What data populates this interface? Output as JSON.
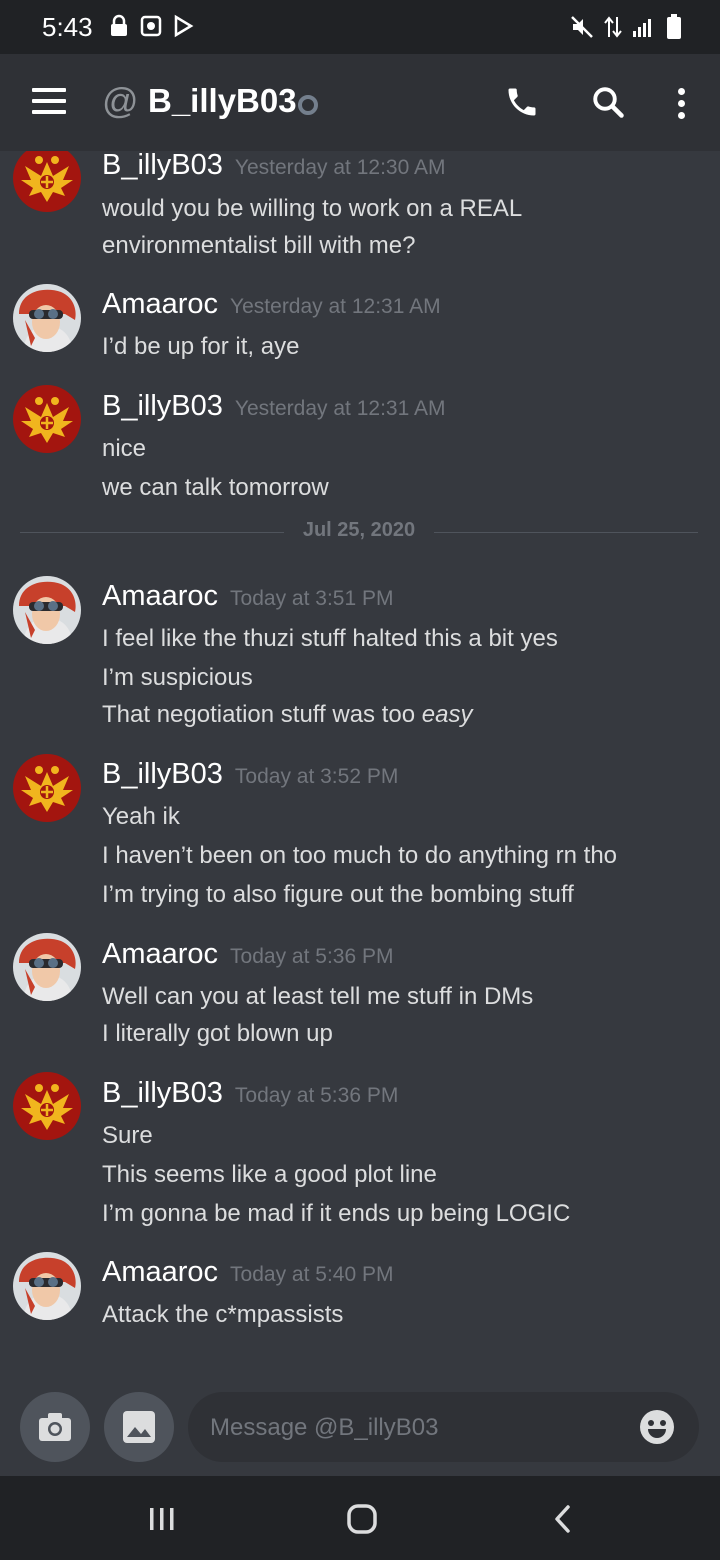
{
  "status_bar": {
    "time": "5:43"
  },
  "header": {
    "at": "@",
    "title": "B_illyB03"
  },
  "messages": [
    {
      "author": "B_illyB03",
      "timestamp": "Yesterday at 12:30 AM",
      "lines": [
        "would you be willing to work on a REAL",
        "environmentalist bill with me?"
      ]
    },
    {
      "author": "Amaaroc",
      "timestamp": "Yesterday at 12:31 AM",
      "lines": [
        "I’d be up for it, aye"
      ]
    },
    {
      "author": "B_illyB03",
      "timestamp": "Yesterday at 12:31 AM",
      "lines": [
        "nice",
        "we can talk tomorrow"
      ]
    },
    {
      "author": "Amaaroc",
      "timestamp": "Today at 3:51 PM",
      "lines": [
        "I feel like the thuzi stuff halted this a bit yes",
        "I’m suspicious",
        "That negotiation stuff was too "
      ],
      "emphasis": "easy"
    },
    {
      "author": "B_illyB03",
      "timestamp": "Today at 3:52 PM",
      "lines": [
        "Yeah ik",
        "I haven’t been on too much to do anything rn tho",
        "I’m trying to also figure out the bombing stuff"
      ]
    },
    {
      "author": "Amaaroc",
      "timestamp": "Today at 5:36 PM",
      "lines": [
        "Well can you at least tell me stuff in DMs",
        "I literally got blown up"
      ]
    },
    {
      "author": "B_illyB03",
      "timestamp": "Today at 5:36 PM",
      "lines": [
        "Sure",
        "This seems like a good plot line",
        "I’m gonna be mad if it ends up being LOGIC"
      ]
    },
    {
      "author": "Amaaroc",
      "timestamp": "Today at 5:40 PM",
      "lines": [
        "Attack the c*mpassists"
      ]
    }
  ],
  "date_divider": "Jul 25, 2020",
  "composer": {
    "placeholder": "Message @B_illyB03"
  },
  "colors": {
    "background": "#36393f",
    "header": "#2f3136",
    "system_bar": "#202225",
    "timestamp": "#72767d",
    "text": "#dcddde"
  },
  "icons": [
    "lock-icon",
    "notification-icon",
    "play-store-icon",
    "mute-icon",
    "data-arrows-icon",
    "signal-icon",
    "battery-icon",
    "hamburger-icon",
    "call-icon",
    "search-icon",
    "more-icon",
    "camera-icon",
    "image-icon",
    "emoji-icon",
    "recents-icon",
    "home-icon",
    "back-icon"
  ]
}
